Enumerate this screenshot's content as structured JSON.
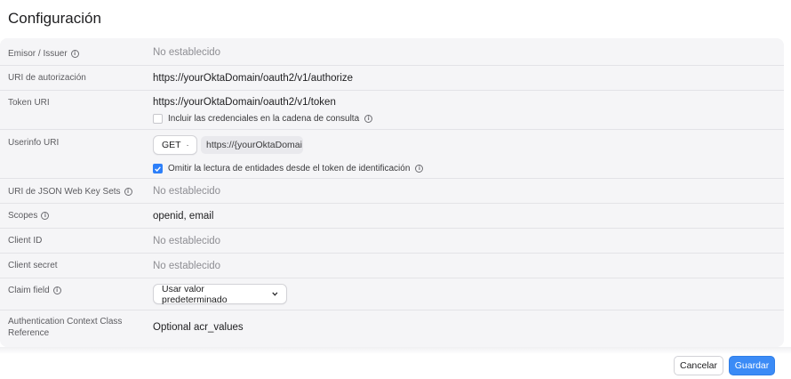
{
  "title": "Configuración",
  "fields": {
    "issuer": {
      "label": "Emisor / Issuer",
      "value": "No establecido"
    },
    "auth_uri": {
      "label": "URI de autorización",
      "value": "https://yourOktaDomain/oauth2/v1/authorize"
    },
    "token_uri": {
      "label": "Token URI",
      "value": "https://yourOktaDomain/oauth2/v1/token",
      "checkbox_label": "Incluir las credenciales en la cadena de consulta",
      "checkbox_checked": false
    },
    "userinfo_uri": {
      "label": "Userinfo URI",
      "method": "GET",
      "value": "https://{yourOktaDomai",
      "checkbox_label": "Omitir la lectura de entidades desde el token de identificación",
      "checkbox_checked": true
    },
    "jwks_uri": {
      "label": "URI de JSON Web Key Sets",
      "value": "No establecido"
    },
    "scopes": {
      "label": "Scopes",
      "value": "openid, email"
    },
    "client_id": {
      "label": "Client ID",
      "value": "No establecido"
    },
    "client_secret": {
      "label": "Client secret",
      "value": "No establecido"
    },
    "claim_field": {
      "label": "Claim field",
      "value": "Usar valor predeterminado"
    },
    "acr": {
      "label_line1": "Authentication Context Class",
      "label_line2": "Reference",
      "value": "Optional acr_values"
    }
  },
  "buttons": {
    "cancel": "Cancelar",
    "save": "Guardar"
  },
  "colors": {
    "accent": "#3b8bf6",
    "panel": "#f5f5f7"
  }
}
